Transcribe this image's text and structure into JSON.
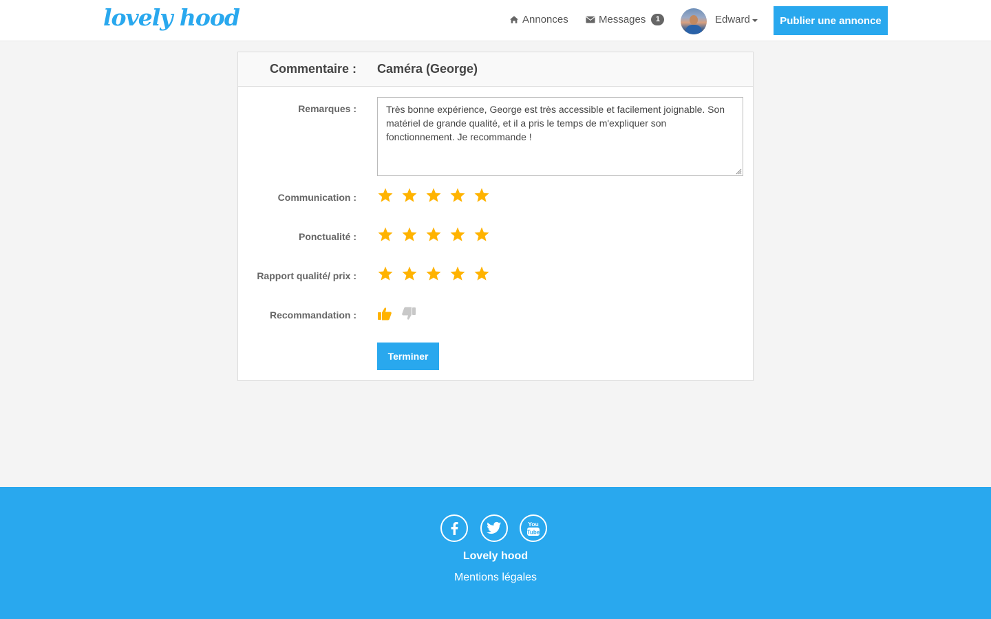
{
  "navbar": {
    "logo": "lovely hood",
    "links": [
      {
        "label": "Annonces",
        "icon": "home-icon"
      },
      {
        "label": "Messages",
        "icon": "envelope-icon",
        "badge": "1"
      }
    ],
    "user_name": "Edward",
    "publish_label": "Publier une annonce"
  },
  "form": {
    "header_label": "Commentaire :",
    "header_title": "Caméra (George)",
    "remarks_label": "Remarques :",
    "remarks_value": "Très bonne expérience, George est très accessible et facilement joignable. Son matériel de grande qualité, et il a pris le temps de m'expliquer son fonctionnement. Je recommande !",
    "ratings": [
      {
        "label": "Communication :",
        "stars": 5,
        "max": 5
      },
      {
        "label": "Ponctualité :",
        "stars": 5,
        "max": 5
      },
      {
        "label": "Rapport qualité/ prix :",
        "stars": 5,
        "max": 5
      }
    ],
    "recommendation_label": "Recommandation :",
    "recommendation": "thumbs-up",
    "finish_label": "Terminer"
  },
  "footer": {
    "social": [
      "facebook-icon",
      "twitter-icon",
      "youtube-icon"
    ],
    "brand": "Lovely hood",
    "legal": "Mentions légales"
  },
  "colors": {
    "accent": "#29a8ee",
    "star": "#ffb300",
    "thumb_inactive": "#c8c8c8"
  }
}
